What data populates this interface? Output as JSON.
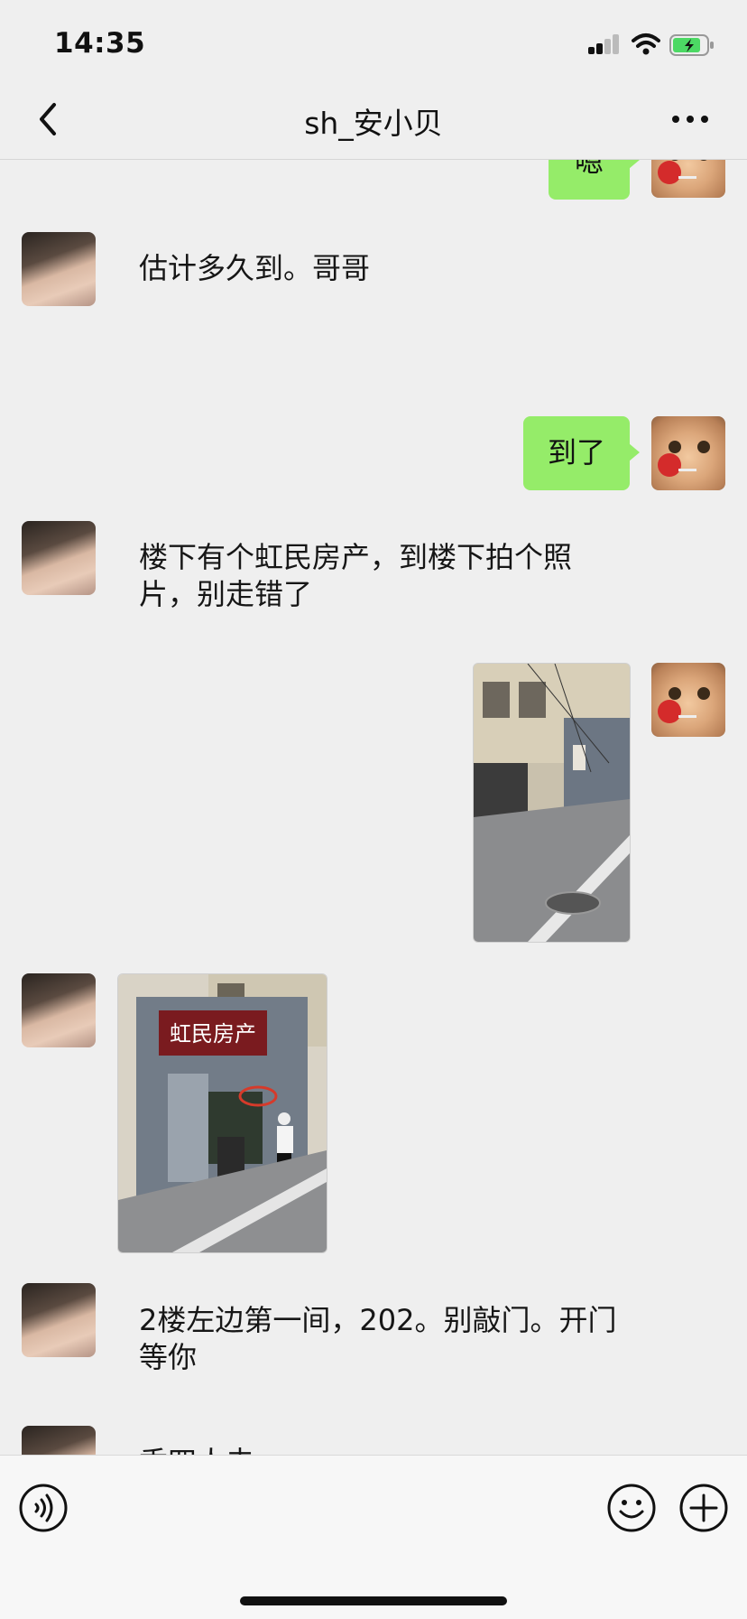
{
  "status_bar": {
    "time": "14:35"
  },
  "header": {
    "title": "sh_安小贝"
  },
  "messages": [
    {
      "from": "me",
      "type": "text",
      "text": "嗯"
    },
    {
      "from": "other",
      "type": "text",
      "text": "估计多久到。哥哥"
    },
    {
      "from": "me",
      "type": "text",
      "text": "到了"
    },
    {
      "from": "other",
      "type": "text",
      "text": "楼下有个虹民房产，到楼下拍个照片，别走错了"
    },
    {
      "from": "me",
      "type": "image",
      "image": "street-photo"
    },
    {
      "from": "other",
      "type": "image",
      "image": "storefront-photo",
      "sign_text": "虹民房产"
    },
    {
      "from": "other",
      "type": "text",
      "text": "2楼左边第一间，202。别敲门。开门等你"
    },
    {
      "from": "other",
      "type": "text",
      "text": "香四人去"
    }
  ],
  "input_bar": {
    "icons": [
      "voice-icon",
      "emoji-icon",
      "plus-icon"
    ]
  },
  "colors": {
    "sent_bubble": "#95ec69",
    "background": "#efefef"
  }
}
